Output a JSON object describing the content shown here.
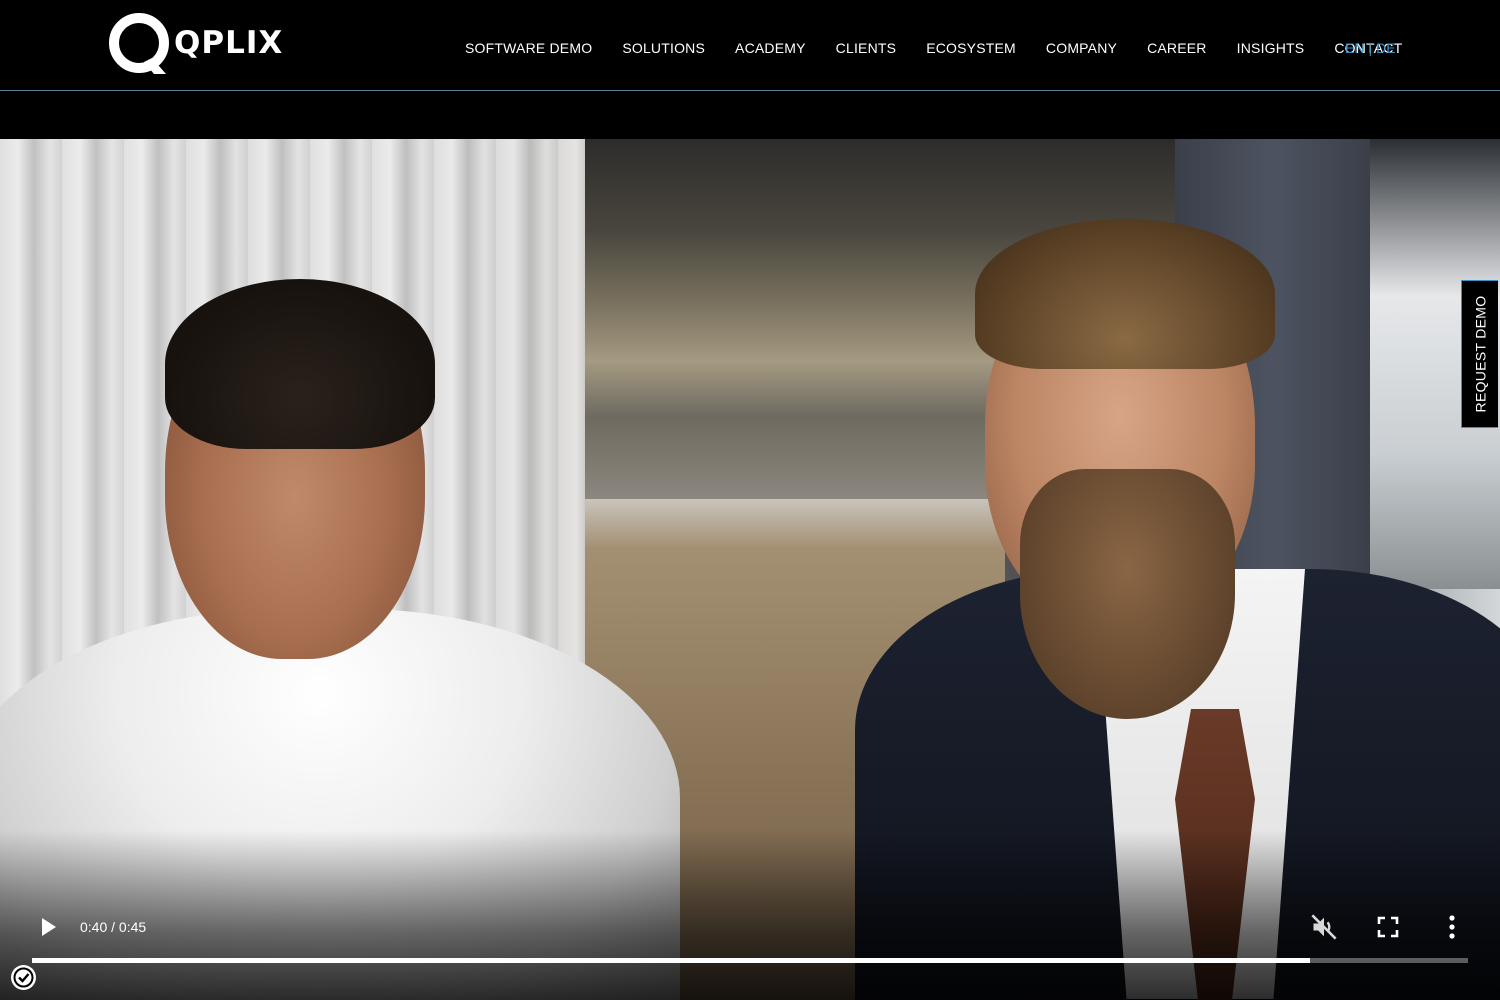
{
  "brand": {
    "name": "QPLIX",
    "accent": "#3d8fc4"
  },
  "nav": {
    "items": [
      {
        "label": "SOFTWARE DEMO"
      },
      {
        "label": "SOLUTIONS"
      },
      {
        "label": "ACADEMY"
      },
      {
        "label": "CLIENTS"
      },
      {
        "label": "ECOSYSTEM"
      },
      {
        "label": "COMPANY"
      },
      {
        "label": "CAREER"
      },
      {
        "label": "INSIGHTS"
      },
      {
        "label": "CONTACT"
      }
    ]
  },
  "lang": {
    "en": "EN",
    "separator": "|",
    "de": "DE"
  },
  "video": {
    "time": "0:40 / 0:45",
    "progress_fraction": 0.89,
    "icons": [
      "play-icon",
      "mute-icon",
      "fullscreen-icon",
      "more-vertical-icon"
    ]
  },
  "side_tab": {
    "label": "REQUEST DEMO"
  },
  "badge": {
    "icon": "shield-check-icon"
  }
}
